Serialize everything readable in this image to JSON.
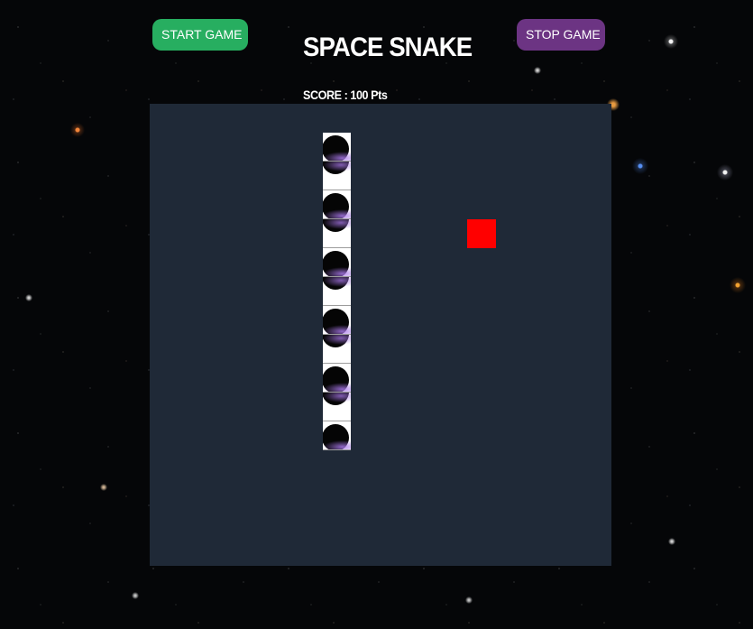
{
  "controls": {
    "start_label": "START GAME",
    "stop_label": "STOP GAME",
    "start_color": "#27ae60",
    "stop_color": "#6c3483"
  },
  "title": "SPACE SNAKE",
  "score": {
    "label": "SCORE :",
    "value": "100",
    "unit": "Pts"
  },
  "board": {
    "background": "#1f2937",
    "cols": 16,
    "rows": 16
  },
  "snake": {
    "segment_image": "black-hole",
    "segments": [
      {
        "col": 6,
        "row": 1
      },
      {
        "col": 6,
        "row": 2
      },
      {
        "col": 6,
        "row": 3
      },
      {
        "col": 6,
        "row": 4
      },
      {
        "col": 6,
        "row": 5
      },
      {
        "col": 6,
        "row": 6
      },
      {
        "col": 6,
        "row": 7
      },
      {
        "col": 6,
        "row": 8
      },
      {
        "col": 6,
        "row": 9
      },
      {
        "col": 6,
        "row": 10
      },
      {
        "col": 6,
        "row": 11
      }
    ]
  },
  "food": {
    "col": 11,
    "row": 4,
    "color": "#ff0000"
  }
}
